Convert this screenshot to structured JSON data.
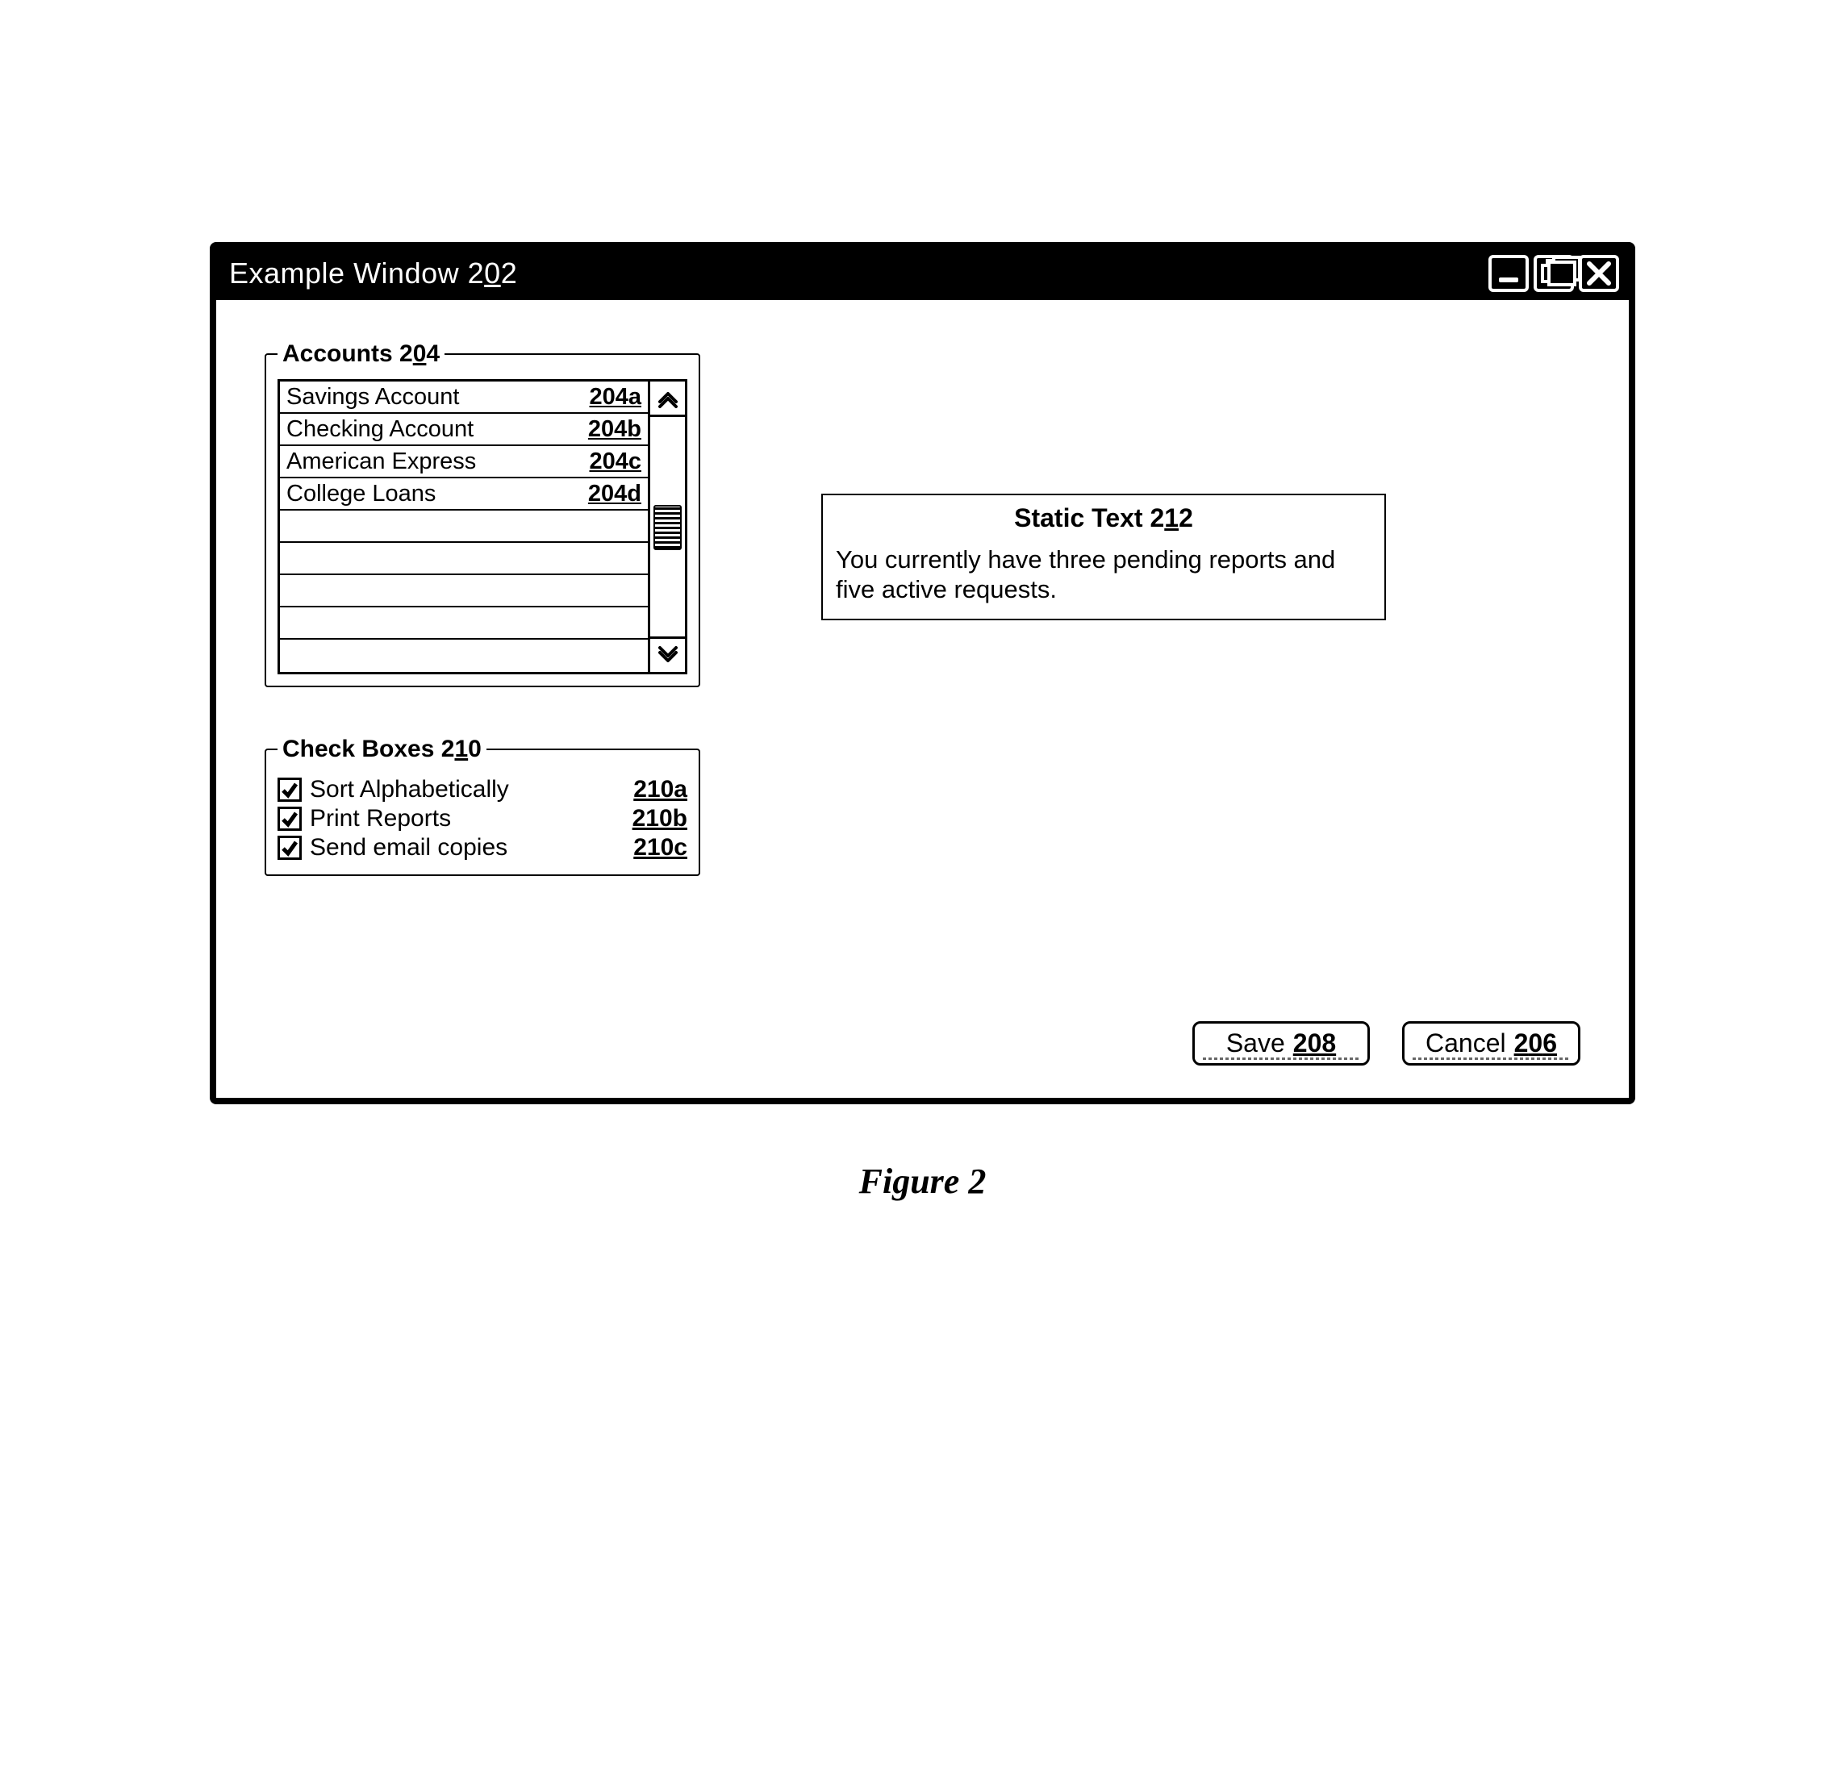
{
  "window": {
    "title_text": "Example Window",
    "title_ref_prefix": "2",
    "title_ref_underlined": "0",
    "title_ref_suffix": "2"
  },
  "accounts": {
    "legend_text": "Accounts",
    "legend_ref_prefix": "2",
    "legend_ref_underlined": "0",
    "legend_ref_suffix": "4",
    "items": [
      {
        "label": "Savings Account",
        "ref": "204a"
      },
      {
        "label": "Checking Account",
        "ref": "204b"
      },
      {
        "label": "American Express",
        "ref": "204c"
      },
      {
        "label": "College Loans",
        "ref": "204d"
      }
    ],
    "empty_rows": 5
  },
  "checkboxes": {
    "legend_text": "Check Boxes",
    "legend_ref_prefix": "2",
    "legend_ref_underlined": "1",
    "legend_ref_suffix": "0",
    "items": [
      {
        "label": "Sort Alphabetically",
        "ref": "210a",
        "checked": true
      },
      {
        "label": "Print Reports",
        "ref": "210b",
        "checked": true
      },
      {
        "label": "Send email copies",
        "ref": "210c",
        "checked": true
      }
    ]
  },
  "static": {
    "title_text": "Static Text",
    "title_ref_prefix": "2",
    "title_ref_underlined": "1",
    "title_ref_suffix": "2",
    "body": "You currently have three pending reports and five active requests."
  },
  "buttons": {
    "save": {
      "label": "Save",
      "ref_prefix": "2",
      "ref_underlined": "0",
      "ref_suffix": "8"
    },
    "cancel": {
      "label": "Cancel",
      "ref_prefix": "2",
      "ref_underlined": "0",
      "ref_suffix": "6"
    }
  },
  "figure_caption": "Figure 2"
}
